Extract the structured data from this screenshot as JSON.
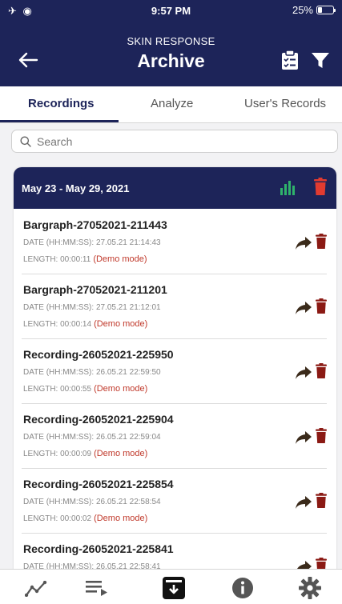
{
  "status_bar": {
    "left_icons": "✈ ◉",
    "time": "9:57 PM",
    "battery_text": "25%",
    "battery_level": 0.25
  },
  "header": {
    "subtitle": "SKIN RESPONSE",
    "title": "Archive",
    "back_icon": "arrow-left-icon",
    "clipboard_icon": "clipboard-check-icon",
    "filter_icon": "filter-icon"
  },
  "tabs": [
    {
      "label": "Recordings",
      "active": true
    },
    {
      "label": "Analyze",
      "active": false
    },
    {
      "label": "User's Records",
      "active": false
    }
  ],
  "search": {
    "placeholder": "Search",
    "value": ""
  },
  "week_group": {
    "label": "May 23 - May 29, 2021",
    "chart_color": "#2fb36b",
    "delete_color": "#e23b30"
  },
  "recordings": [
    {
      "name": "Bargraph-27052021-211443",
      "date_label": "DATE (HH:MM:SS):",
      "date": "27.05.21 21:14:43",
      "length_label": "LENGTH:",
      "length": "00:00:11",
      "mode": "(Demo mode)"
    },
    {
      "name": "Bargraph-27052021-211201",
      "date_label": "DATE (HH:MM:SS):",
      "date": "27.05.21 21:12:01",
      "length_label": "LENGTH:",
      "length": "00:00:14",
      "mode": "(Demo mode)"
    },
    {
      "name": "Recording-26052021-225950",
      "date_label": "DATE (HH:MM:SS):",
      "date": "26.05.21 22:59:50",
      "length_label": "LENGTH:",
      "length": "00:00:55",
      "mode": "(Demo mode)"
    },
    {
      "name": "Recording-26052021-225904",
      "date_label": "DATE (HH:MM:SS):",
      "date": "26.05.21 22:59:04",
      "length_label": "LENGTH:",
      "length": "00:00:09",
      "mode": "(Demo mode)"
    },
    {
      "name": "Recording-26052021-225854",
      "date_label": "DATE (HH:MM:SS):",
      "date": "26.05.21 22:58:54",
      "length_label": "LENGTH:",
      "length": "00:00:02",
      "mode": "(Demo mode)"
    },
    {
      "name": "Recording-26052021-225841",
      "date_label": "DATE (HH:MM:SS):",
      "date": "26.05.21 22:58:41",
      "length_label": "",
      "length": "",
      "mode": ""
    }
  ],
  "bottom_nav": [
    {
      "icon": "line-chart-icon",
      "active": false
    },
    {
      "icon": "playlist-icon",
      "active": false
    },
    {
      "icon": "archive-icon",
      "active": true
    },
    {
      "icon": "info-icon",
      "active": false
    },
    {
      "icon": "settings-gear-icon",
      "active": false
    }
  ],
  "colors": {
    "navy": "#1d2459",
    "accent_red": "#c0392b",
    "share_brown": "#3a2a1a",
    "delete_dark_red": "#8b1a14"
  }
}
